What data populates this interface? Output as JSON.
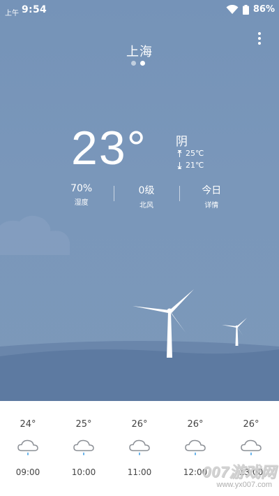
{
  "status_bar": {
    "ampm": "上午",
    "time": "9:54",
    "battery": "86%"
  },
  "header": {
    "city": "上海",
    "page_count": 2,
    "active_page": 2
  },
  "current": {
    "temperature": "23°",
    "condition": "阴",
    "high": "25℃",
    "low": "21℃"
  },
  "stats": [
    {
      "value": "70%",
      "label": "湿度"
    },
    {
      "value": "0级",
      "label": "北风"
    },
    {
      "value": "今日",
      "label": "详情"
    }
  ],
  "hourly": [
    {
      "temp": "24°",
      "time": "09:00",
      "icon": "light-rain-icon"
    },
    {
      "temp": "25°",
      "time": "10:00",
      "icon": "light-rain-icon"
    },
    {
      "temp": "26°",
      "time": "11:00",
      "icon": "light-rain-icon"
    },
    {
      "temp": "26°",
      "time": "12:00",
      "icon": "light-rain-icon"
    },
    {
      "temp": "26°",
      "time": "13:00",
      "icon": "light-rain-icon"
    }
  ],
  "watermark": {
    "brand": "007游戏网",
    "url": "www.yx007.com"
  },
  "colors": {
    "sky": "#7593b8",
    "hill_back": "#6a86ab",
    "hill_front": "#5b789f",
    "rain_drop": "#4aa3e6"
  }
}
